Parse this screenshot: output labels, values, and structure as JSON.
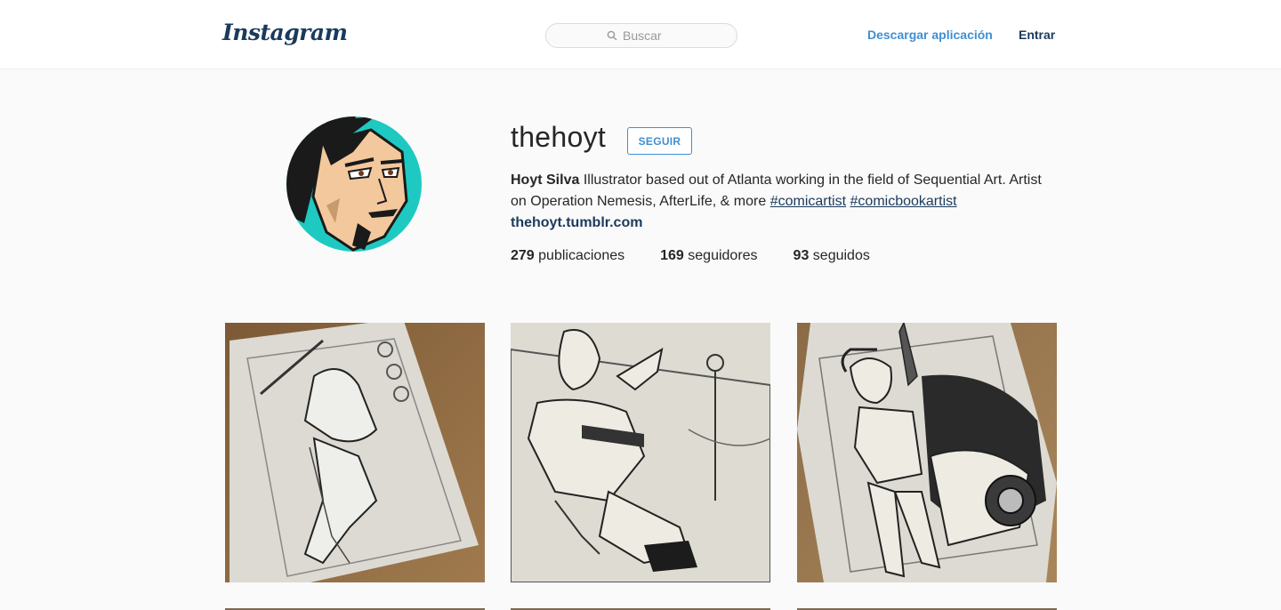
{
  "header": {
    "logo": "Instagram",
    "search_placeholder": "Buscar",
    "download_link": "Descargar aplicación",
    "login_link": "Entrar"
  },
  "profile": {
    "username": "thehoyt",
    "follow_label": "SEGUIR",
    "full_name": "Hoyt Silva",
    "bio_text": "Illustrator based out of Atlanta working in the field of Sequential Art. Artist on Operation Nemesis, AfterLife, & more",
    "hashtags": [
      "#comicartist",
      "#comicbookartist"
    ],
    "website": "thehoyt.tumblr.com",
    "stats": {
      "posts_count": "279",
      "posts_label": "publicaciones",
      "followers_count": "169",
      "followers_label": "seguidores",
      "following_count": "93",
      "following_label": "seguidos"
    }
  },
  "posts": [
    {
      "description": "ink drawing of a character with a sword"
    },
    {
      "description": "ink drawing of a muscular fighter"
    },
    {
      "description": "ink drawing of a girl with a blaster and a car"
    }
  ],
  "colors": {
    "link_blue": "#3f8fd2",
    "dark_blue": "#1b3a5c",
    "avatar_bg": "#1ec9c2"
  }
}
